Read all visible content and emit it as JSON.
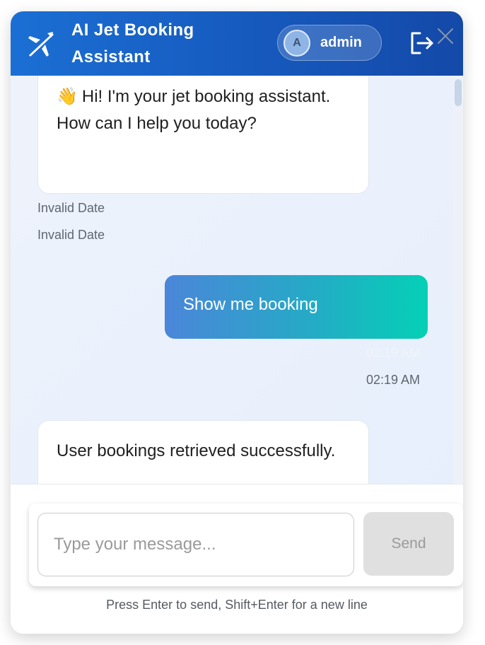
{
  "header": {
    "title": "AI Jet Booking Assistant",
    "user": {
      "initial": "A",
      "name": "admin"
    },
    "icons": {
      "logo": "airplane-icon",
      "logout": "logout-icon",
      "close": "close-icon"
    }
  },
  "messages": [
    {
      "sender": "assistant",
      "emoji": "👋",
      "text": "Hi! I'm your jet booking assistant. How can I help you today?",
      "timestamps": [
        "Invalid Date",
        "Invalid Date"
      ]
    },
    {
      "sender": "user",
      "text": "Show me booking",
      "timestamps": [
        "02:19 AM",
        "02:19 AM"
      ]
    },
    {
      "sender": "assistant",
      "text": "User bookings retrieved successfully."
    }
  ],
  "composer": {
    "placeholder": "Type your message...",
    "send_label": "Send",
    "hint": "Press Enter to send, Shift+Enter for a new line"
  },
  "colors": {
    "header": "#1659bd",
    "user_bubble_start": "#4b86d9",
    "user_bubble_end": "#04d0b6",
    "send_disabled": "#e0e0e0"
  }
}
